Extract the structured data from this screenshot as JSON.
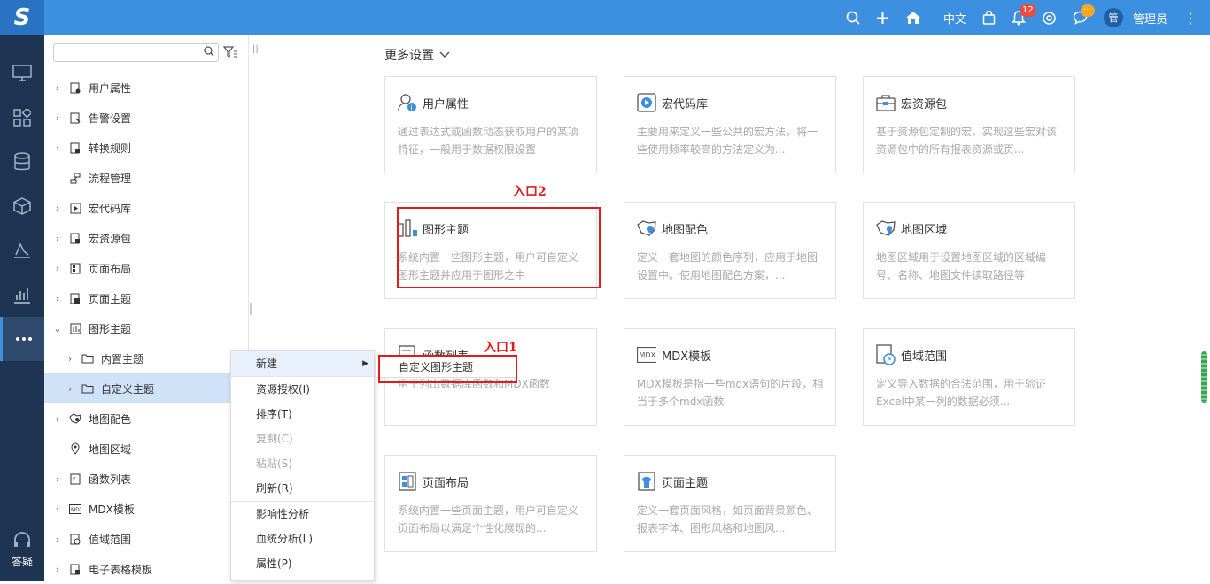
{
  "logo": "S",
  "topbar": {
    "language": "中文",
    "notification_count": "12",
    "message_badge": "···",
    "avatar_text": "管",
    "user_name": "管理员"
  },
  "rail": {
    "help_label": "答疑"
  },
  "tree": {
    "search_placeholder": "",
    "items": [
      {
        "label": "用户属性"
      },
      {
        "label": "告警设置"
      },
      {
        "label": "转换规则"
      },
      {
        "label": "流程管理"
      },
      {
        "label": "宏代码库"
      },
      {
        "label": "宏资源包"
      },
      {
        "label": "页面布局"
      },
      {
        "label": "页面主题"
      },
      {
        "label": "图形主题"
      },
      {
        "label": "内置主题"
      },
      {
        "label": "自定义主题"
      },
      {
        "label": "地图配色"
      },
      {
        "label": "地图区域"
      },
      {
        "label": "函数列表"
      },
      {
        "label": "MDX模板"
      },
      {
        "label": "值域范围"
      },
      {
        "label": "电子表格模板"
      }
    ]
  },
  "context_menu": {
    "items": [
      {
        "label": "新建"
      },
      {
        "label": "资源授权(I)"
      },
      {
        "label": "排序(T)"
      },
      {
        "label": "复制(C)"
      },
      {
        "label": "粘贴(S)"
      },
      {
        "label": "刷新(R)"
      },
      {
        "label": "影响性分析"
      },
      {
        "label": "血统分析(L)"
      },
      {
        "label": "属性(P)"
      }
    ],
    "submenu_item": "自定义图形主题"
  },
  "main": {
    "more_settings": "更多设置",
    "cards": [
      {
        "title": "用户属性",
        "desc": "通过表达式或函数动态获取用户的某项特征，一般用于数据权限设置",
        "icon": "user-info-icon"
      },
      {
        "title": "宏代码库",
        "desc": "主要用来定义一些公共的宏方法，将一些使用频率较高的方法定义为...",
        "icon": "macro-code-icon"
      },
      {
        "title": "宏资源包",
        "desc": "基于资源包定制的宏，实现这些宏对该资源包中的所有报表资源或页...",
        "icon": "macro-package-icon"
      },
      {
        "title": "图形主题",
        "desc": "系统内置一些图形主题，用户可自定义图形主题并应用于图形之中",
        "icon": "chart-theme-icon"
      },
      {
        "title": "地图配色",
        "desc": "定义一套地图的颜色序列，应用于地图设置中。使用地图配色方案，...",
        "icon": "map-color-icon"
      },
      {
        "title": "地图区域",
        "desc": "地图区域用于设置地图区域的区域编号、名称、地图文件读取路径等",
        "icon": "map-area-icon"
      },
      {
        "title": "函数列表",
        "desc": "用于列出数据库函数和MDX函数",
        "icon": "function-list-icon"
      },
      {
        "title": "MDX模板",
        "desc": "MDX模板是指一些mdx语句的片段，相当于多个mdx函数",
        "icon": "mdx-template-icon"
      },
      {
        "title": "值域范围",
        "desc": "定义导入数据的合法范围，用于验证Excel中某一列的数据必须...",
        "icon": "value-range-icon"
      },
      {
        "title": "页面布局",
        "desc": "系统内置一些页面主题，用户可自定义页面布局以满足个性化展现的...",
        "icon": "page-layout-icon"
      },
      {
        "title": "页面主题",
        "desc": "定义一套页面风格，如页面背景颜色、报表字体、图形风格和地图风...",
        "icon": "page-theme-icon"
      }
    ]
  },
  "annotations": {
    "entry1": "入口1",
    "entry2": "入口2"
  },
  "colors": {
    "topbar": "#3d8fe0",
    "rail": "#1d3553",
    "highlight": "#e01b1b",
    "selected": "#cfe2f7"
  }
}
